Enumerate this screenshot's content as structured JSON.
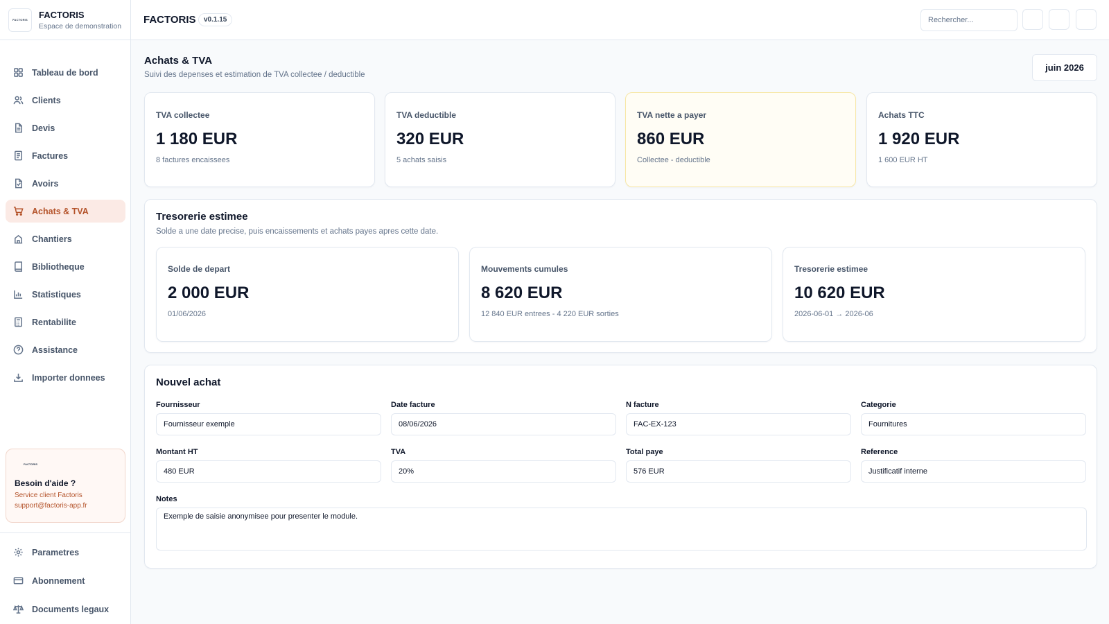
{
  "brand": {
    "logo_text": "FACTORIS",
    "name": "FACTORIS",
    "subtitle": "Espace de demonstration"
  },
  "sidebar": {
    "items": [
      {
        "label": "Tableau de bord",
        "icon": "dashboard-icon"
      },
      {
        "label": "Clients",
        "icon": "users-icon"
      },
      {
        "label": "Devis",
        "icon": "document-icon"
      },
      {
        "label": "Factures",
        "icon": "invoice-icon"
      },
      {
        "label": "Avoirs",
        "icon": "credit-note-icon"
      },
      {
        "label": "Achats & TVA",
        "icon": "cart-icon",
        "active": true
      },
      {
        "label": "Chantiers",
        "icon": "building-icon"
      },
      {
        "label": "Bibliotheque",
        "icon": "book-icon"
      },
      {
        "label": "Statistiques",
        "icon": "bar-chart-icon"
      },
      {
        "label": "Rentabilite",
        "icon": "calculator-icon"
      },
      {
        "label": "Assistance",
        "icon": "help-circle-icon"
      },
      {
        "label": "Importer donnees",
        "icon": "download-icon"
      }
    ],
    "help": {
      "logo_text": "FACTORIS",
      "title": "Besoin d'aide ?",
      "line1": "Service client Factoris",
      "line2": "support@factoris-app.fr"
    },
    "bottom_items": [
      {
        "label": "Parametres",
        "icon": "gear-icon"
      },
      {
        "label": "Abonnement",
        "icon": "credit-card-icon"
      },
      {
        "label": "Documents legaux",
        "icon": "scale-icon"
      }
    ]
  },
  "header": {
    "title": "FACTORIS",
    "version": "v0.1.15",
    "search_placeholder": "Rechercher..."
  },
  "page": {
    "title": "Achats & TVA",
    "subtitle": "Suivi des depenses et estimation de TVA collectee / deductible",
    "month": "juin 2026"
  },
  "kpis": [
    {
      "label": "TVA collectee",
      "value": "1 180 EUR",
      "sub": "8 factures encaissees"
    },
    {
      "label": "TVA deductible",
      "value": "320 EUR",
      "sub": "5 achats saisis"
    },
    {
      "label": "TVA nette a payer",
      "value": "860 EUR",
      "sub": "Collectee - deductible",
      "highlight": true
    },
    {
      "label": "Achats TTC",
      "value": "1 920 EUR",
      "sub": "1 600 EUR HT"
    }
  ],
  "treso": {
    "title": "Tresorerie estimee",
    "subtitle": "Solde a une date precise, puis encaissements et achats payes apres cette date.",
    "cards": [
      {
        "label": "Solde de depart",
        "value": "2 000 EUR",
        "sub": "01/06/2026"
      },
      {
        "label": "Mouvements cumules",
        "value": "8 620 EUR",
        "sub": "12 840 EUR entrees - 4 220 EUR sorties"
      },
      {
        "label": "Tresorerie estimee",
        "value": "10 620 EUR",
        "sub": "2026-06-01 → 2026-06"
      }
    ]
  },
  "form": {
    "title": "Nouvel achat",
    "fields": [
      {
        "label": "Fournisseur",
        "value": "Fournisseur exemple"
      },
      {
        "label": "Date facture",
        "value": "08/06/2026"
      },
      {
        "label": "N facture",
        "value": "FAC-EX-123"
      },
      {
        "label": "Categorie",
        "value": "Fournitures"
      },
      {
        "label": "Montant HT",
        "value": "480 EUR"
      },
      {
        "label": "TVA",
        "value": "20%"
      },
      {
        "label": "Total paye",
        "value": "576 EUR"
      },
      {
        "label": "Reference",
        "value": "Justificatif interne"
      }
    ],
    "notes": {
      "label": "Notes",
      "value": "Exemple de saisie anonymisee pour presenter le module."
    }
  }
}
